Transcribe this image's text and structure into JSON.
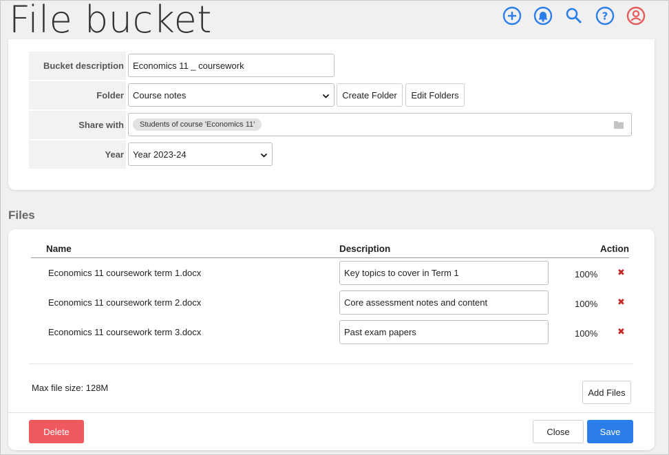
{
  "header": {
    "title": "File bucket",
    "icons": [
      "add-circle-icon",
      "bell-icon",
      "search-icon",
      "help-icon",
      "user-icon"
    ],
    "icon_color": "#2b7de9",
    "user_icon_color": "#e35b5b"
  },
  "form": {
    "description_label": "Bucket description",
    "description_value": "Economics 11 _ coursework",
    "folder_label": "Folder",
    "folder_value": "Course notes",
    "create_folder_label": "Create Folder",
    "edit_folders_label": "Edit Folders",
    "share_label": "Share with",
    "share_chip": "Students of course 'Economics 11'",
    "year_label": "Year",
    "year_value": "Year 2023-24"
  },
  "files": {
    "section_title": "Files",
    "columns": {
      "name": "Name",
      "description": "Description",
      "action": "Action"
    },
    "rows": [
      {
        "name": "Economics 11 coursework term 1.docx",
        "description": "Key topics to cover in Term 1",
        "progress": "100%"
      },
      {
        "name": "Economics 11 coursework term 2.docx",
        "description": "Core assessment notes and content",
        "progress": "100%"
      },
      {
        "name": "Economics 11 coursework term 3.docx",
        "description": "Past exam papers",
        "progress": "100%"
      }
    ],
    "max_size": "Max file size: 128M",
    "add_files_label": "Add Files"
  },
  "footer": {
    "delete_label": "Delete",
    "close_label": "Close",
    "save_label": "Save"
  },
  "colors": {
    "delete": "#f0595e",
    "save": "#2b7de9",
    "remove_x": "#c62828"
  }
}
